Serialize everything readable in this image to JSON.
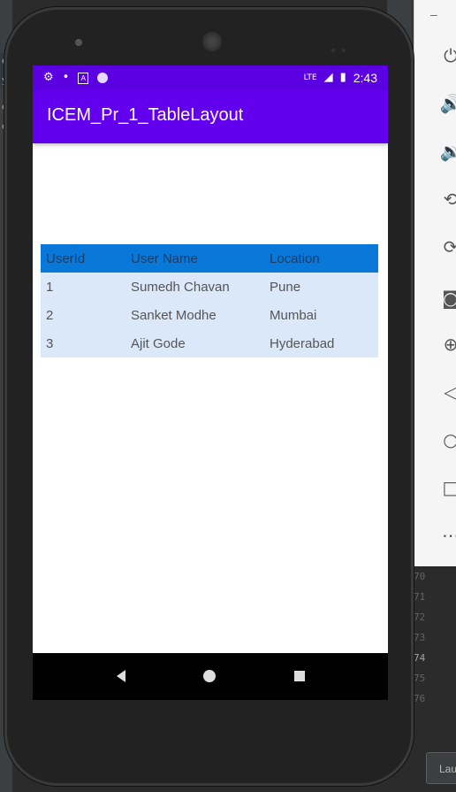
{
  "status_bar": {
    "time": "2:43",
    "network": "LTE",
    "icons": [
      "gear-icon",
      "dash-icon",
      "a-square-icon",
      "circle-icon",
      "signal-icon",
      "battery-icon"
    ]
  },
  "app": {
    "title": "ICEM_Pr_1_TableLayout"
  },
  "table": {
    "headers": [
      "UserId",
      "User Name",
      "Location"
    ],
    "rows": [
      [
        "1",
        "Sumedh Chavan",
        "Pune"
      ],
      [
        "2",
        "Sanket Modhe",
        "Mumbai"
      ],
      [
        "3",
        "Ajit Gode",
        "Hyderabad"
      ]
    ],
    "colors": {
      "header_bg": "#0a78d8",
      "row_bg": "#dbe8fa"
    }
  },
  "emulator_panel": {
    "tools": [
      "power-icon",
      "volume-up-icon",
      "volume-down-icon",
      "rotate-left-icon",
      "rotate-right-icon",
      "camera-icon",
      "zoom-icon",
      "back-icon",
      "home-icon",
      "overview-icon",
      "more-icon"
    ]
  },
  "ide": {
    "line_numbers": [
      "70",
      "71",
      "72",
      "73",
      "74",
      "75",
      "76"
    ],
    "current_line": "74",
    "button_label": "Lau"
  },
  "theme": {
    "primary": "#6200ee",
    "status": "#5b00e0"
  }
}
